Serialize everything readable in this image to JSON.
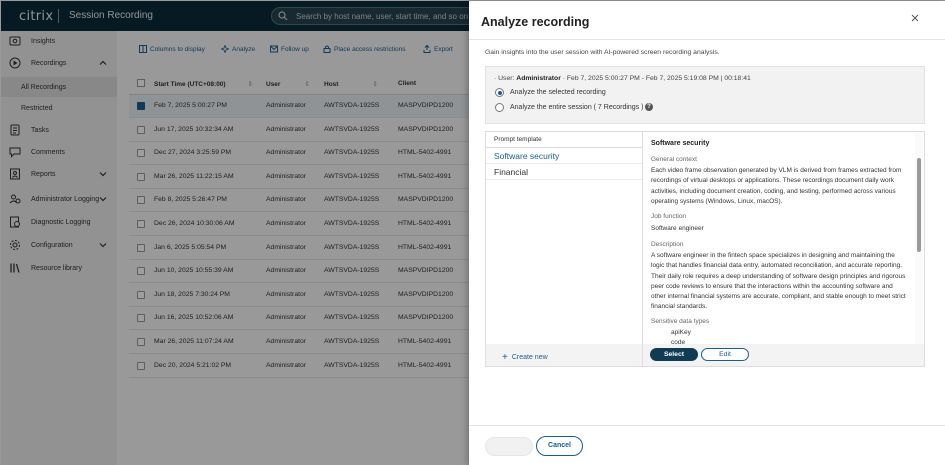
{
  "header": {
    "logo": "citrix",
    "product": "Session Recording",
    "search_placeholder": "Search by host name, user, start time, and so on"
  },
  "sidebar": {
    "items": [
      {
        "label": "Insights",
        "icon": "insights-icon"
      },
      {
        "label": "Recordings",
        "icon": "recordings-icon"
      },
      {
        "label": "Tasks",
        "icon": "tasks-icon"
      },
      {
        "label": "Comments",
        "icon": "comments-icon"
      },
      {
        "label": "Reports",
        "icon": "reports-icon"
      },
      {
        "label": "Administrator Logging",
        "icon": "admin-logging-icon"
      },
      {
        "label": "Diagnostic Logging",
        "icon": "diagnostic-logging-icon"
      },
      {
        "label": "Configuration",
        "icon": "configuration-icon"
      },
      {
        "label": "Resource library",
        "icon": "resource-library-icon"
      }
    ],
    "sub_items": [
      {
        "label": "All Recordings"
      },
      {
        "label": "Restricted"
      }
    ]
  },
  "toolbar": {
    "columns": "Columns to display",
    "analyze": "Analyze",
    "follow_up": "Follow up",
    "restrictions": "Place access restrictions",
    "export": "Export"
  },
  "table": {
    "headers": {
      "start_time": "Start Time (UTC+08:00)",
      "user": "User",
      "host": "Host",
      "client": "Client"
    },
    "rows": [
      {
        "start": "Feb 7, 2025 5:00:27 PM",
        "user": "Administrator",
        "host": "AWTSVDA-1925S",
        "client": "MASPVDIPD1200"
      },
      {
        "start": "Jun 17, 2025 10:32:34 AM",
        "user": "Administrator",
        "host": "AWTSVDA-1925S",
        "client": "MASPVDIPD1200"
      },
      {
        "start": "Dec 27, 2024 3:25:59 PM",
        "user": "Administrator",
        "host": "AWTSVDA-1925S",
        "client": "HTML-5402-4991"
      },
      {
        "start": "Mar 26, 2025 11:22:15 AM",
        "user": "Administrator",
        "host": "AWTSVDA-1925S",
        "client": "HTML-5402-4991"
      },
      {
        "start": "Feb 8, 2025 5:26:47 PM",
        "user": "Administrator",
        "host": "AWTSVDA-1925S",
        "client": "MASPVDIPD1200"
      },
      {
        "start": "Dec 26, 2024 10:30:06 AM",
        "user": "Administrator",
        "host": "AWTSVDA-1925S",
        "client": "HTML-5402-4991"
      },
      {
        "start": "Jan 6, 2025 5:05:54 PM",
        "user": "Administrator",
        "host": "AWTSVDA-1925S",
        "client": "HTML-5402-4991"
      },
      {
        "start": "Jun 10, 2025 10:55:39 AM",
        "user": "Administrator",
        "host": "AWTSVDA-1925S",
        "client": "MASPVDIPD1200"
      },
      {
        "start": "Jun 18, 2025 7:30:24 PM",
        "user": "Administrator",
        "host": "AWTSVDA-1925S",
        "client": "MASPVDIPD1200"
      },
      {
        "start": "Jun 16, 2025 10:52:06 AM",
        "user": "Administrator",
        "host": "AWTSVDA-1925S",
        "client": "MASPVDIPD1200"
      },
      {
        "start": "Mar 26, 2025 11:07:24 AM",
        "user": "Administrator",
        "host": "AWTSVDA-1925S",
        "client": "HTML-5402-4991"
      },
      {
        "start": "Dec 20, 2024 5:21:02 PM",
        "user": "Administrator",
        "host": "AWTSVDA-1925S",
        "client": "HTML-5402-4991"
      }
    ]
  },
  "panel": {
    "title": "Analyze recording",
    "description": "Gain insights into the user session with AI-powered screen recording analysis.",
    "session": {
      "user_prefix": "· User: ",
      "user": "Administrator",
      "range": " · Feb 7, 2025 5:00:27 PM - Feb 7, 2025 5:19:08 PM  |  00:18:41",
      "option_selected": "Analyze the selected recording",
      "option_entire": "Analyze the entire session ( 7 Recordings )"
    },
    "prompt": {
      "header": "Prompt template",
      "items": [
        "Software security",
        "Financial"
      ],
      "create_new": "Create new",
      "detail": {
        "title": "Software security",
        "context_label": "General context",
        "context": "Each video frame observation generated by VLM is derived from frames extracted from recordings of virtual desktops or applications. These recordings document daily work activities, including document creation, coding, and testing, performed across various operating systems (Windows, Linux, macOS).",
        "job_label": "Job function",
        "job": "Software engineer",
        "desc_label": "Description",
        "desc": "A software engineer in the fintech space specializes in designing and maintaining the logic that handles financial data entry, automated reconciliation, and accurate reporting. Their daily role requires a deep understanding of software design principles and rigorous peer code reviews to ensure that the interactions within the accounting software and other internal financial systems are accurate, compliant, and stable enough to meet strict financial standards.",
        "sensitive_label": "Sensitive data types",
        "sensitive_items": [
          "apiKey",
          "code"
        ]
      },
      "select": "Select",
      "edit": "Edit"
    },
    "cancel": "Cancel"
  }
}
